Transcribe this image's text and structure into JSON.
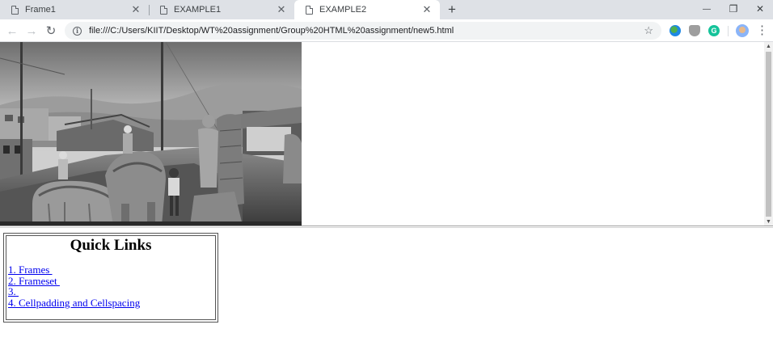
{
  "browser": {
    "tabs": [
      {
        "title": "Frame1",
        "active": false
      },
      {
        "title": "EXAMPLE1",
        "active": false
      },
      {
        "title": "EXAMPLE2",
        "active": true
      }
    ],
    "new_tab_glyph": "+",
    "window_controls": {
      "minimize": "—",
      "restore": "❐",
      "close": "✕"
    },
    "nav": {
      "back": "←",
      "forward": "→",
      "reload": "↻"
    },
    "url": "file:///C:/Users/KIIT/Desktop/WT%20assignment/Group%20HTML%20assignment/new5.html",
    "icons": [
      "info-icon",
      "star-icon",
      "globe-extension-icon",
      "shield-extension-icon",
      "grammarly-icon",
      "avatar",
      "menu-icon"
    ]
  },
  "top_frame": {
    "image": "black-and-white photo of rooftop with elephant statues and children",
    "scrollbar": {
      "up": "▲",
      "down": "▼"
    }
  },
  "quick_links": {
    "heading": "Quick Links",
    "links": [
      "1. Frames ",
      "2. Frameset ",
      "3. ",
      "4. Cellpadding and Cellspacing"
    ]
  },
  "colors": {
    "link": "#0000ee",
    "tabstrip": "#dee1e6"
  }
}
